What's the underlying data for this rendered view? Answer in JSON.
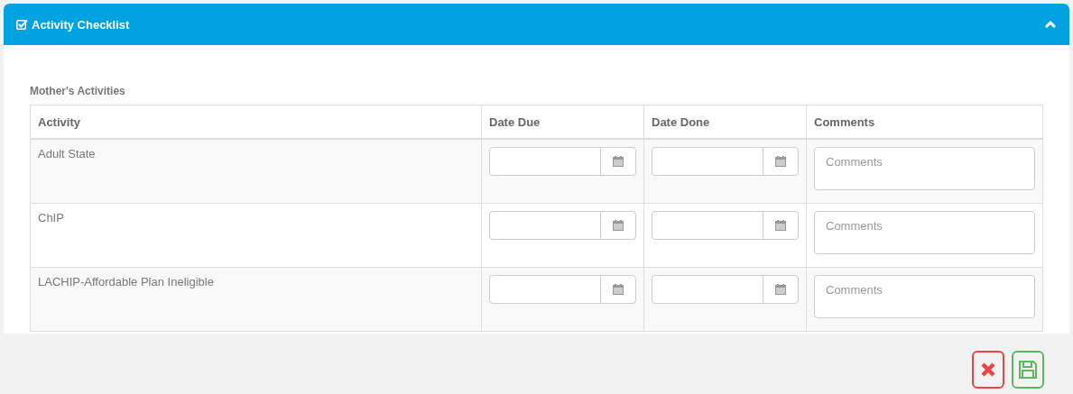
{
  "panel": {
    "title": "Activity Checklist",
    "expanded": true
  },
  "section_title": "Mother's Activities",
  "table": {
    "columns": [
      "Activity",
      "Date Due",
      "Date Done",
      "Comments"
    ],
    "rows": [
      {
        "activity": "Adult State",
        "comments_placeholder": "Comments"
      },
      {
        "activity": "ChIP",
        "comments_placeholder": "Comments"
      },
      {
        "activity": "LACHIP-Affordable Plan Ineligible",
        "comments_placeholder": "Comments"
      }
    ]
  }
}
